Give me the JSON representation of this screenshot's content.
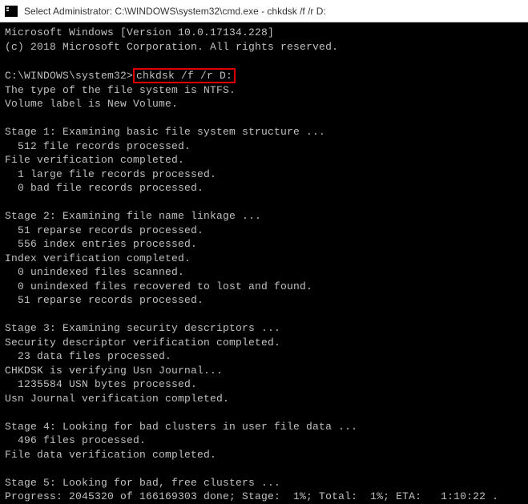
{
  "titlebar": {
    "title": "Select Administrator: C:\\WINDOWS\\system32\\cmd.exe - chkdsk  /f /r D:"
  },
  "term": {
    "header1": "Microsoft Windows [Version 10.0.17134.228]",
    "header2": "(c) 2018 Microsoft Corporation. All rights reserved.",
    "prompt": "C:\\WINDOWS\\system32>",
    "command": "chkdsk /f /r D:",
    "fs_type": "The type of the file system is NTFS.",
    "vol_label": "Volume label is New Volume.",
    "stage1_title": "Stage 1: Examining basic file system structure ...",
    "stage1_l1": "  512 file records processed.",
    "stage1_l2": "File verification completed.",
    "stage1_l3": "  1 large file records processed.",
    "stage1_l4": "  0 bad file records processed.",
    "stage2_title": "Stage 2: Examining file name linkage ...",
    "stage2_l1": "  51 reparse records processed.",
    "stage2_l2": "  556 index entries processed.",
    "stage2_l3": "Index verification completed.",
    "stage2_l4": "  0 unindexed files scanned.",
    "stage2_l5": "  0 unindexed files recovered to lost and found.",
    "stage2_l6": "  51 reparse records processed.",
    "stage3_title": "Stage 3: Examining security descriptors ...",
    "stage3_l1": "Security descriptor verification completed.",
    "stage3_l2": "  23 data files processed.",
    "stage3_l3": "CHKDSK is verifying Usn Journal...",
    "stage3_l4": "  1235584 USN bytes processed.",
    "stage3_l5": "Usn Journal verification completed.",
    "stage4_title": "Stage 4: Looking for bad clusters in user file data ...",
    "stage4_l1": "  496 files processed.",
    "stage4_l2": "File data verification completed.",
    "stage5_title": "Stage 5: Looking for bad, free clusters ...",
    "progress": "Progress: 2045320 of 166169303 done; Stage:  1%; Total:  1%; ETA:   1:10:22 ."
  }
}
